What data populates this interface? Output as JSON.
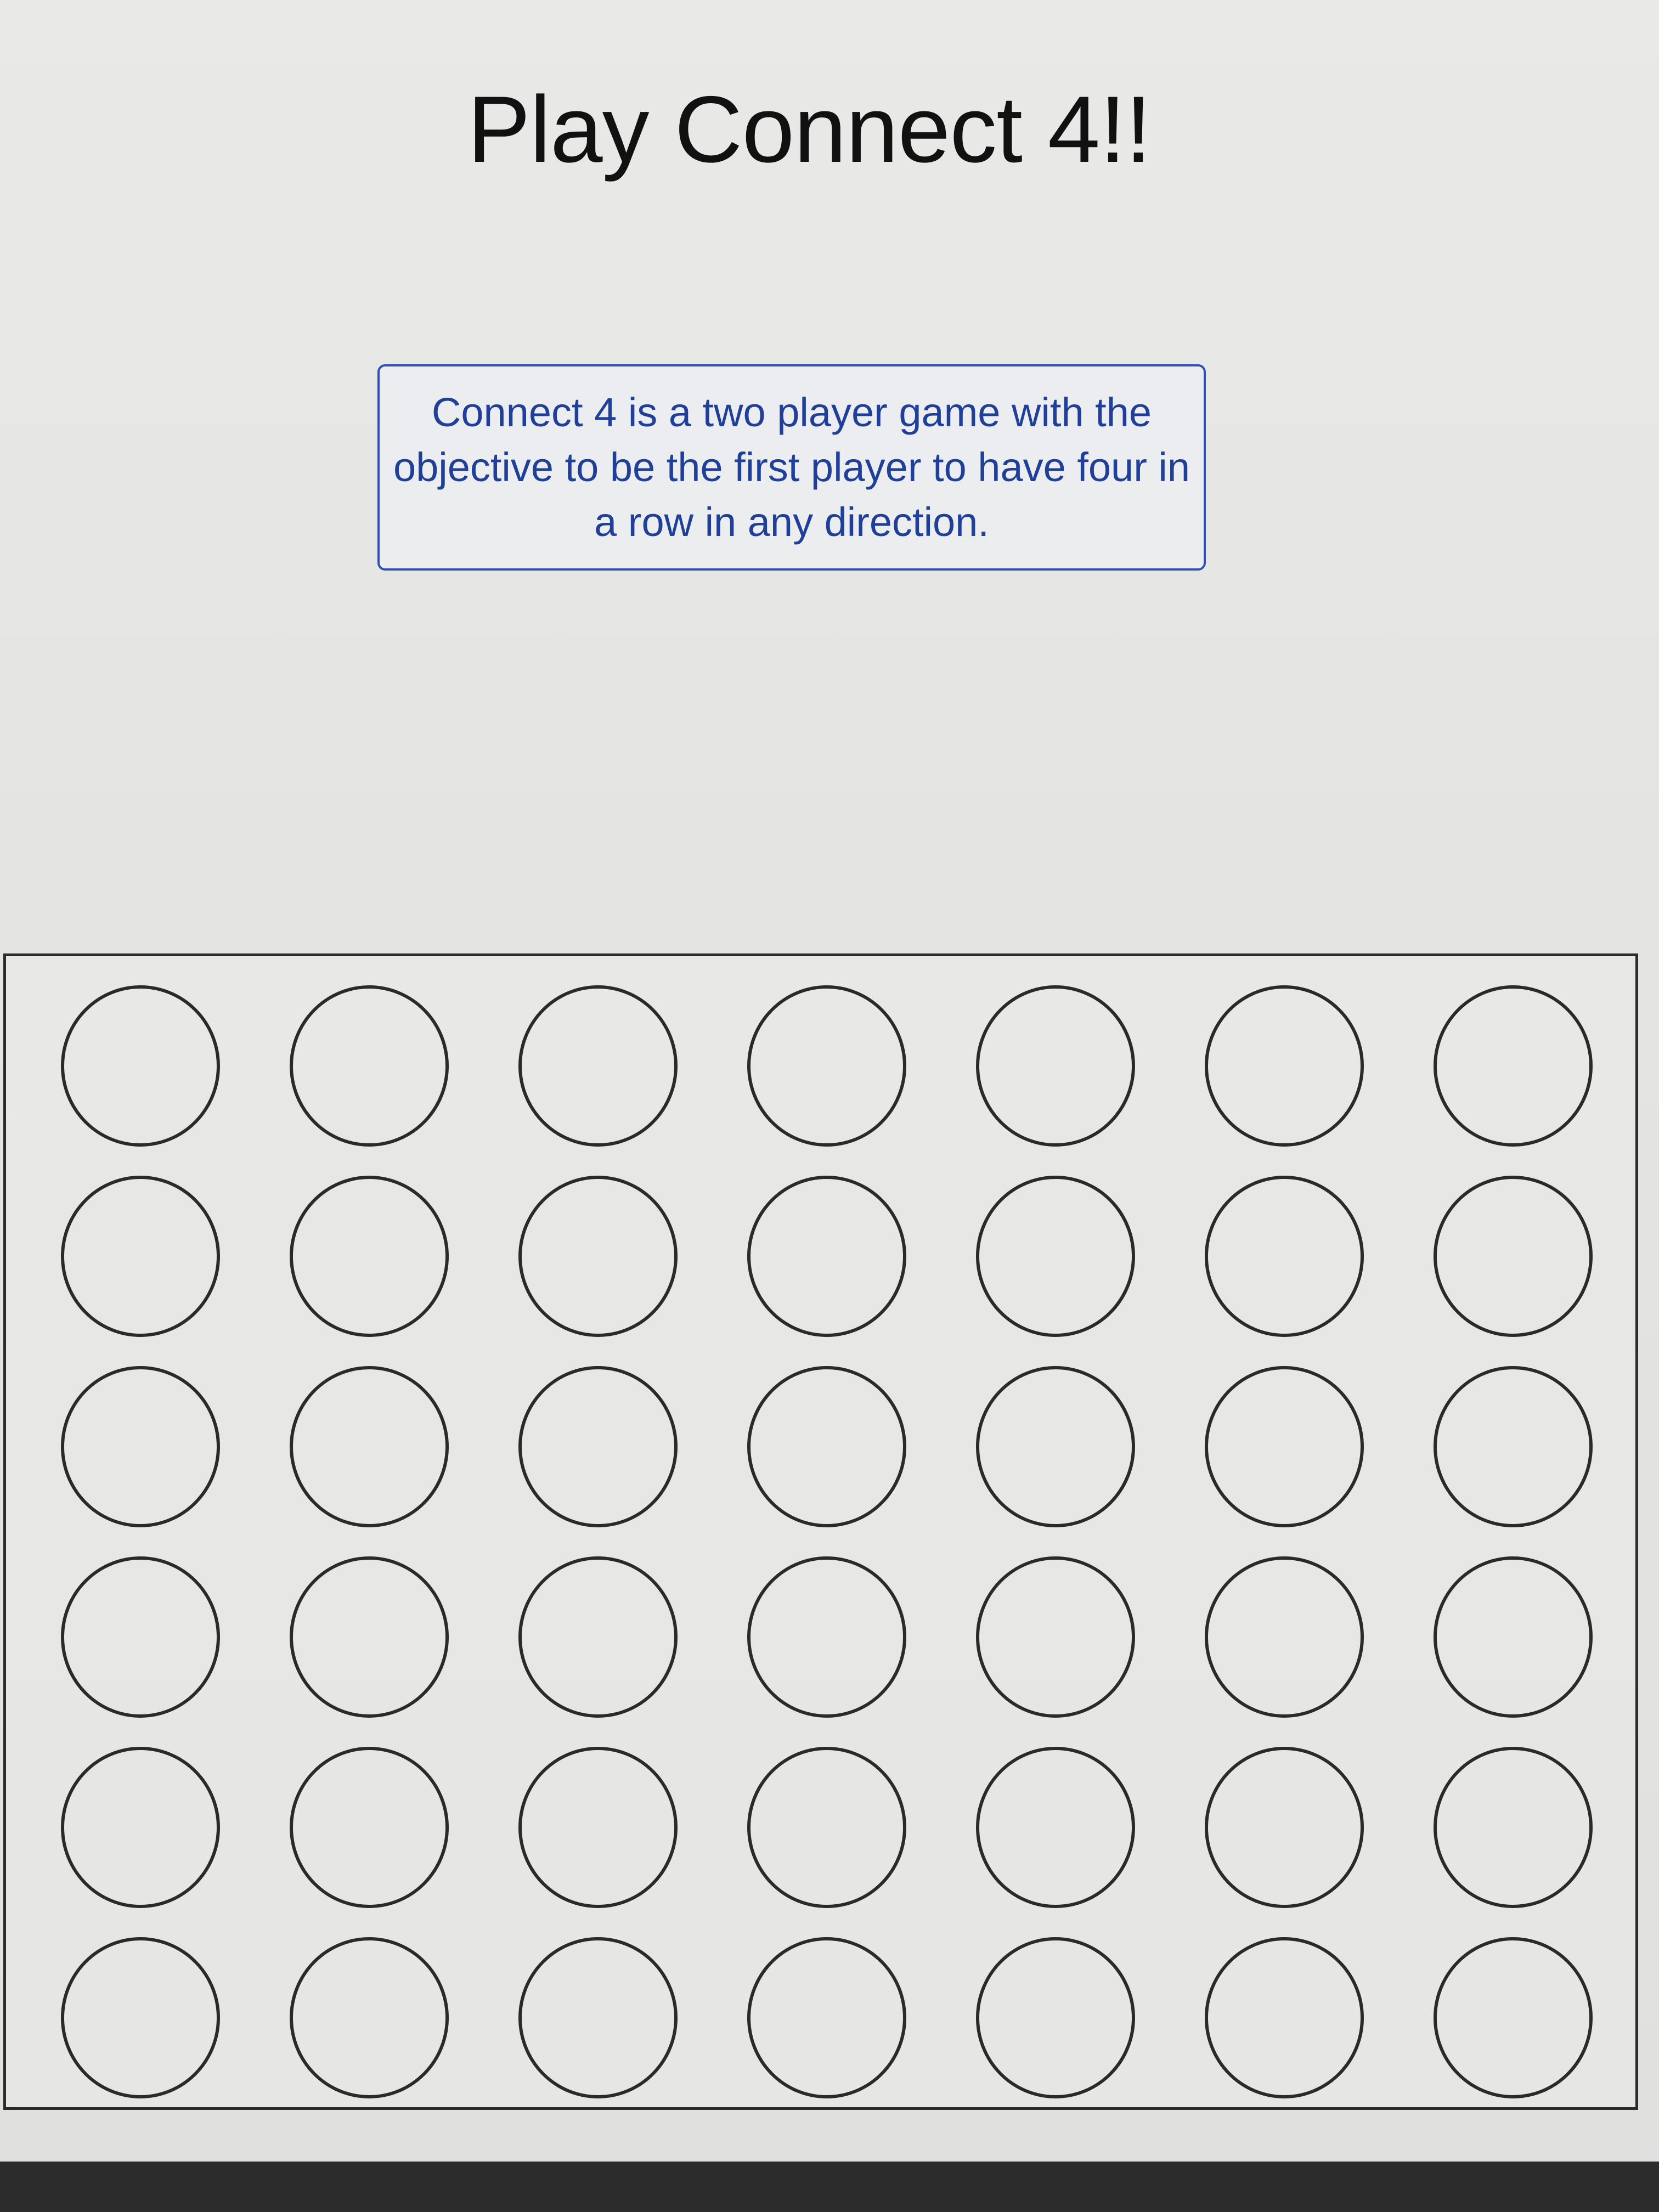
{
  "page": {
    "title": "Play Connect 4!!",
    "description": "Connect 4 is a two player game with the objective to be the first player to have four in a row in any direction."
  },
  "board": {
    "columns": 7,
    "rows": 6,
    "cells": [
      [
        "empty",
        "empty",
        "empty",
        "empty",
        "empty",
        "empty",
        "empty"
      ],
      [
        "empty",
        "empty",
        "empty",
        "empty",
        "empty",
        "empty",
        "empty"
      ],
      [
        "empty",
        "empty",
        "empty",
        "empty",
        "empty",
        "empty",
        "empty"
      ],
      [
        "empty",
        "empty",
        "empty",
        "empty",
        "empty",
        "empty",
        "empty"
      ],
      [
        "empty",
        "empty",
        "empty",
        "empty",
        "empty",
        "empty",
        "empty"
      ],
      [
        "empty",
        "empty",
        "empty",
        "empty",
        "empty",
        "empty",
        "empty"
      ]
    ]
  },
  "colors": {
    "description_border": "#2e52b4",
    "description_text": "#1f3f99",
    "board_border": "#2b2b2b"
  }
}
